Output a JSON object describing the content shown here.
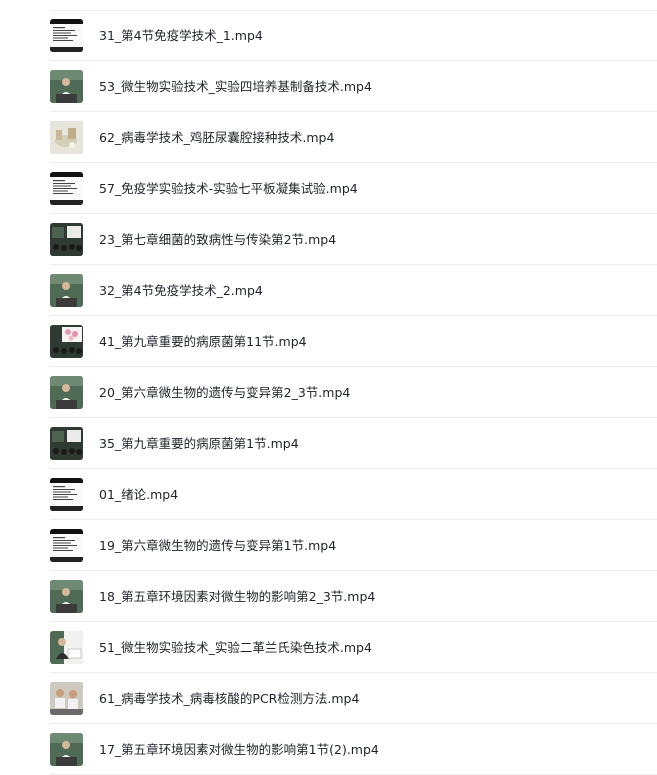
{
  "files": [
    {
      "name": "31_第4节免疫学技术_1.mp4",
      "thumb": "slide"
    },
    {
      "name": "53_微生物实验技术_实验四培养基制备技术.mp4",
      "thumb": "lecturer"
    },
    {
      "name": "62_病毒学技术_鸡胚尿囊腔接种技术.mp4",
      "thumb": "lab"
    },
    {
      "name": "57_免疫学实验技术-实验七平板凝集试验.mp4",
      "thumb": "slide"
    },
    {
      "name": "23_第七章细菌的致病性与传染第2节.mp4",
      "thumb": "classroom"
    },
    {
      "name": "32_第4节免疫学技术_2.mp4",
      "thumb": "lecturer"
    },
    {
      "name": "41_第九章重要的病原菌第11节.mp4",
      "thumb": "classroom-pink"
    },
    {
      "name": "20_第六章微生物的遗传与变异第2_3节.mp4",
      "thumb": "lecturer"
    },
    {
      "name": "35_第九章重要的病原菌第1节.mp4",
      "thumb": "classroom"
    },
    {
      "name": "01_绪论.mp4",
      "thumb": "slide"
    },
    {
      "name": "19_第六章微生物的遗传与变异第1节.mp4",
      "thumb": "slide"
    },
    {
      "name": "18_第五章环境因素对微生物的影响第2_3节.mp4",
      "thumb": "lecturer"
    },
    {
      "name": "51_微生物实验技术_实验二革兰氏染色技术.mp4",
      "thumb": "lecturer-side"
    },
    {
      "name": "61_病毒学技术_病毒核酸的PCR检测方法.mp4",
      "thumb": "lab-people"
    },
    {
      "name": "17_第五章环境因素对微生物的影响第1节(2).mp4",
      "thumb": "lecturer"
    }
  ]
}
